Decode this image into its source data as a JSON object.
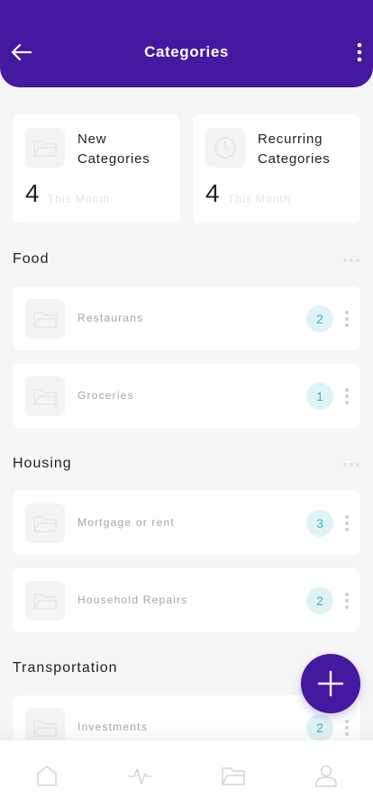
{
  "header": {
    "title": "Categories"
  },
  "stats": [
    {
      "label": "New Categories",
      "count": "4",
      "sub": "This Month"
    },
    {
      "label": "Recurring Categories",
      "count": "4",
      "sub": "This Month"
    }
  ],
  "sections": [
    {
      "title": "Food",
      "items": [
        {
          "label": "Restaurans",
          "count": "2"
        },
        {
          "label": "Groceries",
          "count": "1"
        }
      ]
    },
    {
      "title": "Housing",
      "items": [
        {
          "label": "Mortgage or rent",
          "count": "3"
        },
        {
          "label": "Household Repairs",
          "count": "2"
        }
      ]
    },
    {
      "title": "Transportation",
      "items": [
        {
          "label": "Investments",
          "count": "2"
        }
      ]
    }
  ],
  "bottom_nav": [
    "home-icon",
    "activity-icon",
    "folder-icon",
    "profile-icon"
  ],
  "colors": {
    "primary": "#44199f",
    "badge_bg": "#dff3f6",
    "badge_text": "#30b6c7"
  }
}
